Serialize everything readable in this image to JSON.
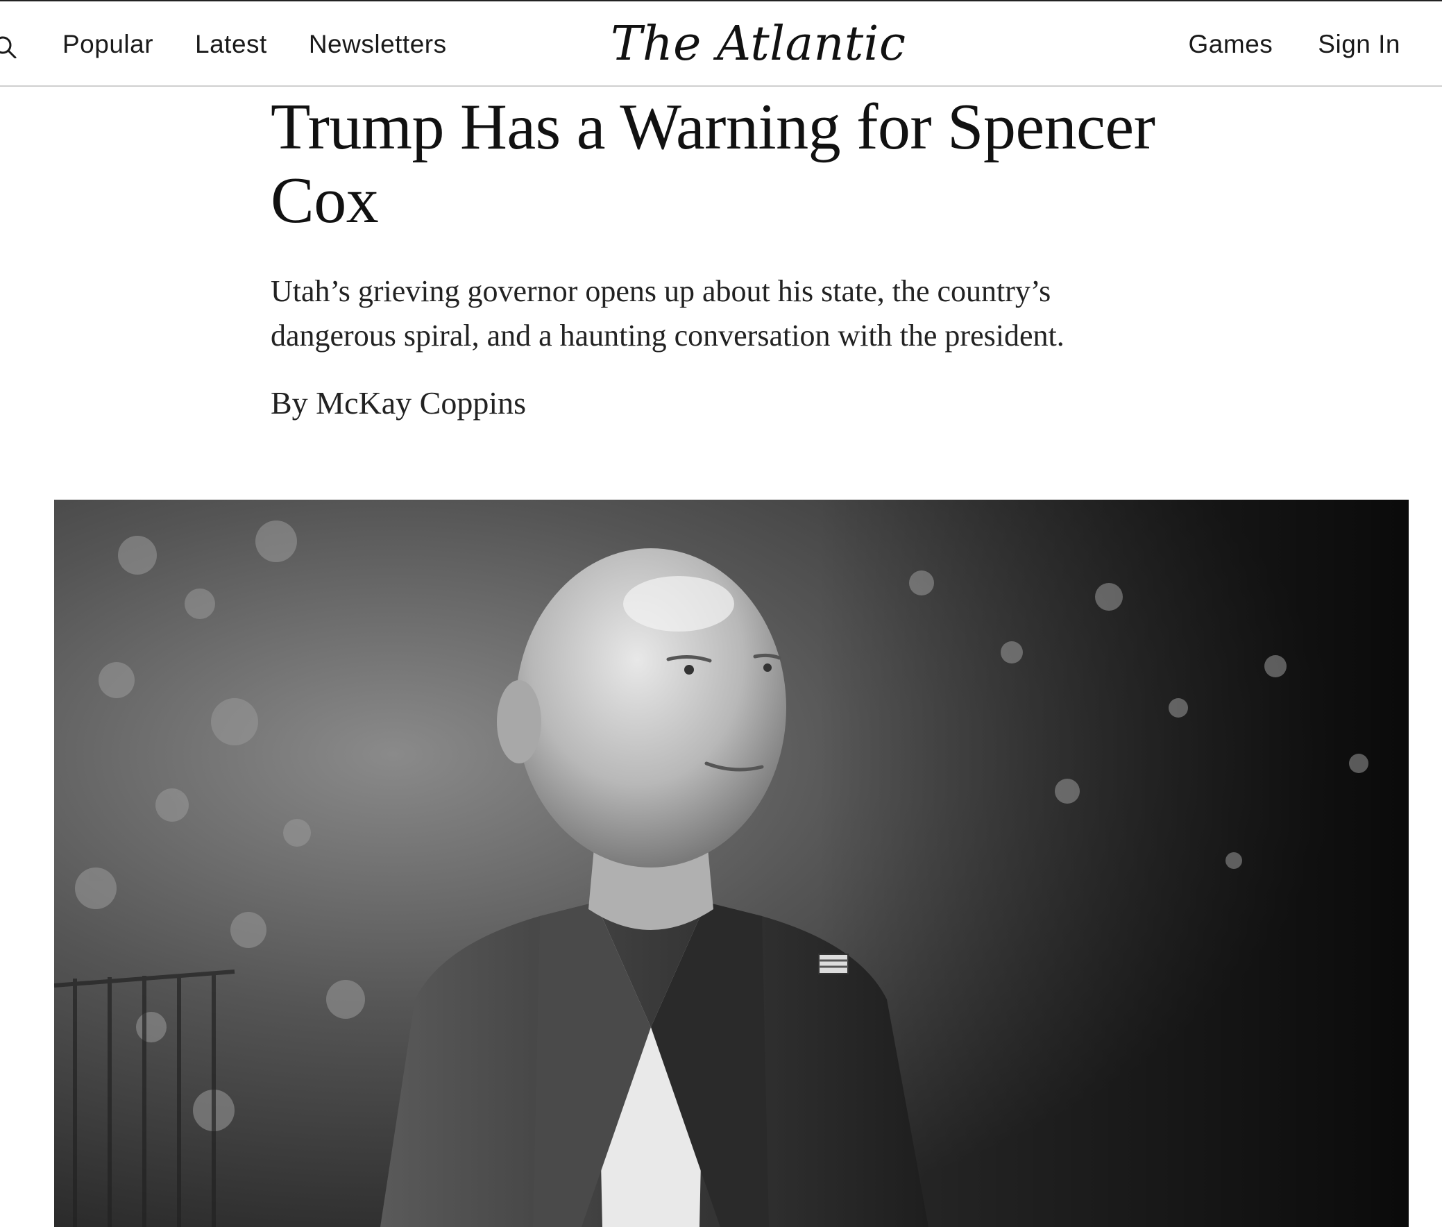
{
  "header": {
    "logo": "The Atlantic",
    "nav_left": [
      "Popular",
      "Latest",
      "Newsletters"
    ],
    "nav_right": [
      "Games",
      "Sign In"
    ],
    "search_icon": "search-icon"
  },
  "article": {
    "headline_line1": "Trump Has a Warning for Spencer",
    "headline_line2": "Cox",
    "dek_line1": "Utah’s grieving governor opens up about his state, the country’s",
    "dek_line2": "dangerous spiral, and a haunting conversation with the president.",
    "byline": "By McKay Coppins"
  },
  "hero_image": {
    "style": "black-and-white portrait photo"
  }
}
